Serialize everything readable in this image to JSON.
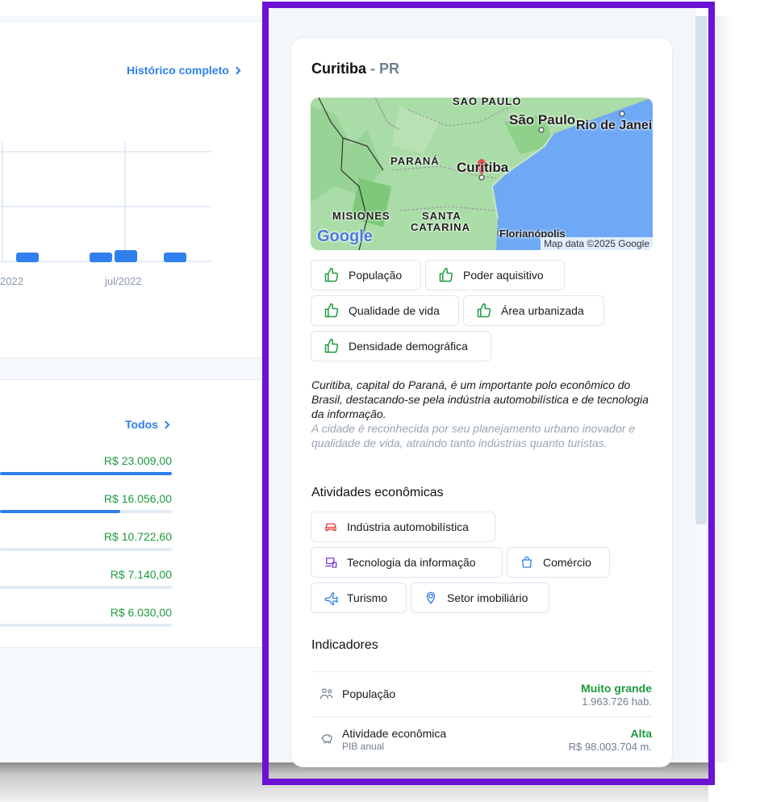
{
  "chart_card": {
    "history_link": "Histórico completo",
    "x_ticks": [
      "2022",
      "jul/2022"
    ]
  },
  "chart_data": {
    "type": "bar",
    "title": "",
    "xlabel": "",
    "ylabel": "",
    "x_ticks": [
      "2022",
      "jul/2022"
    ],
    "values": [
      1,
      1,
      1,
      1
    ],
    "grid": true
  },
  "ranking_card": {
    "all_link": "Todos",
    "items": [
      {
        "value": "R$ 23.009,00",
        "fill": 1.0
      },
      {
        "value": "R$ 16.056,00",
        "fill": 0.7
      },
      {
        "value": "R$ 10.722,60",
        "fill": 0.47
      },
      {
        "value": "R$ 7.140,00",
        "fill": 0.31
      },
      {
        "value": "R$ 6.030,00",
        "fill": 0.26
      }
    ]
  },
  "city": {
    "name": "Curitiba",
    "state": "PR",
    "separator": " - "
  },
  "map": {
    "labels": {
      "sao_paulo_state": "SÃO PAULO",
      "sao_paulo_city": "São Paulo",
      "rio": "Rio de Janei",
      "parana": "PARANÁ",
      "curitiba": "Curitiba",
      "misiones": "MISIONES",
      "santa": "SANTA",
      "catarina": "CATARINA",
      "florianopolis": "Florianópolis",
      "google": "Google",
      "attribution": "Map data ©2025 Google"
    }
  },
  "highlights": [
    {
      "label": "População",
      "icon": "thumbs-up-icon"
    },
    {
      "label": "Poder aquisitivo",
      "icon": "thumbs-up-icon"
    },
    {
      "label": "Qualidade de vida",
      "icon": "thumbs-up-icon"
    },
    {
      "label": "Área urbanizada",
      "icon": "thumbs-up-icon"
    },
    {
      "label": "Densidade demográfica",
      "icon": "thumbs-up-icon"
    }
  ],
  "description": {
    "p1": "Curitiba, capital do Paraná, é um importante polo econômico do Brasil, destacando-se pela indústria automobilística e de tecnologia da informação.",
    "p2": "A cidade é reconhecida por seu planejamento urbano inovador e qualidade de vida, atraindo tanto indústrias quanto turistas."
  },
  "activities": {
    "title": "Atividades econômicas",
    "items": [
      {
        "label": "Indústria automobilística",
        "icon": "car-icon",
        "color": "#e53935"
      },
      {
        "label": "Tecnologia da informação",
        "icon": "laptop-icon",
        "color": "#7b3fe4"
      },
      {
        "label": "Comércio",
        "icon": "shopping-bag-icon",
        "color": "#2f80ed"
      },
      {
        "label": "Turismo",
        "icon": "airplane-icon",
        "color": "#2f80ed"
      },
      {
        "label": "Setor imobiliário",
        "icon": "location-icon",
        "color": "#2f80ed"
      }
    ]
  },
  "indicators": {
    "title": "Indicadores",
    "items": [
      {
        "label": "População",
        "sub": "",
        "level": "Muito grande",
        "value": "1.963.726 hab.",
        "icon": "people-icon"
      },
      {
        "label": "Atividade econômica",
        "sub": "PIB anual",
        "level": "Alta",
        "value": "R$ 98.003.704 m.",
        "icon": "piggy-bank-icon"
      }
    ]
  },
  "colors": {
    "accent": "#2f80ed",
    "positive": "#1e9a3e",
    "highlight_frame": "#6c12d4"
  }
}
